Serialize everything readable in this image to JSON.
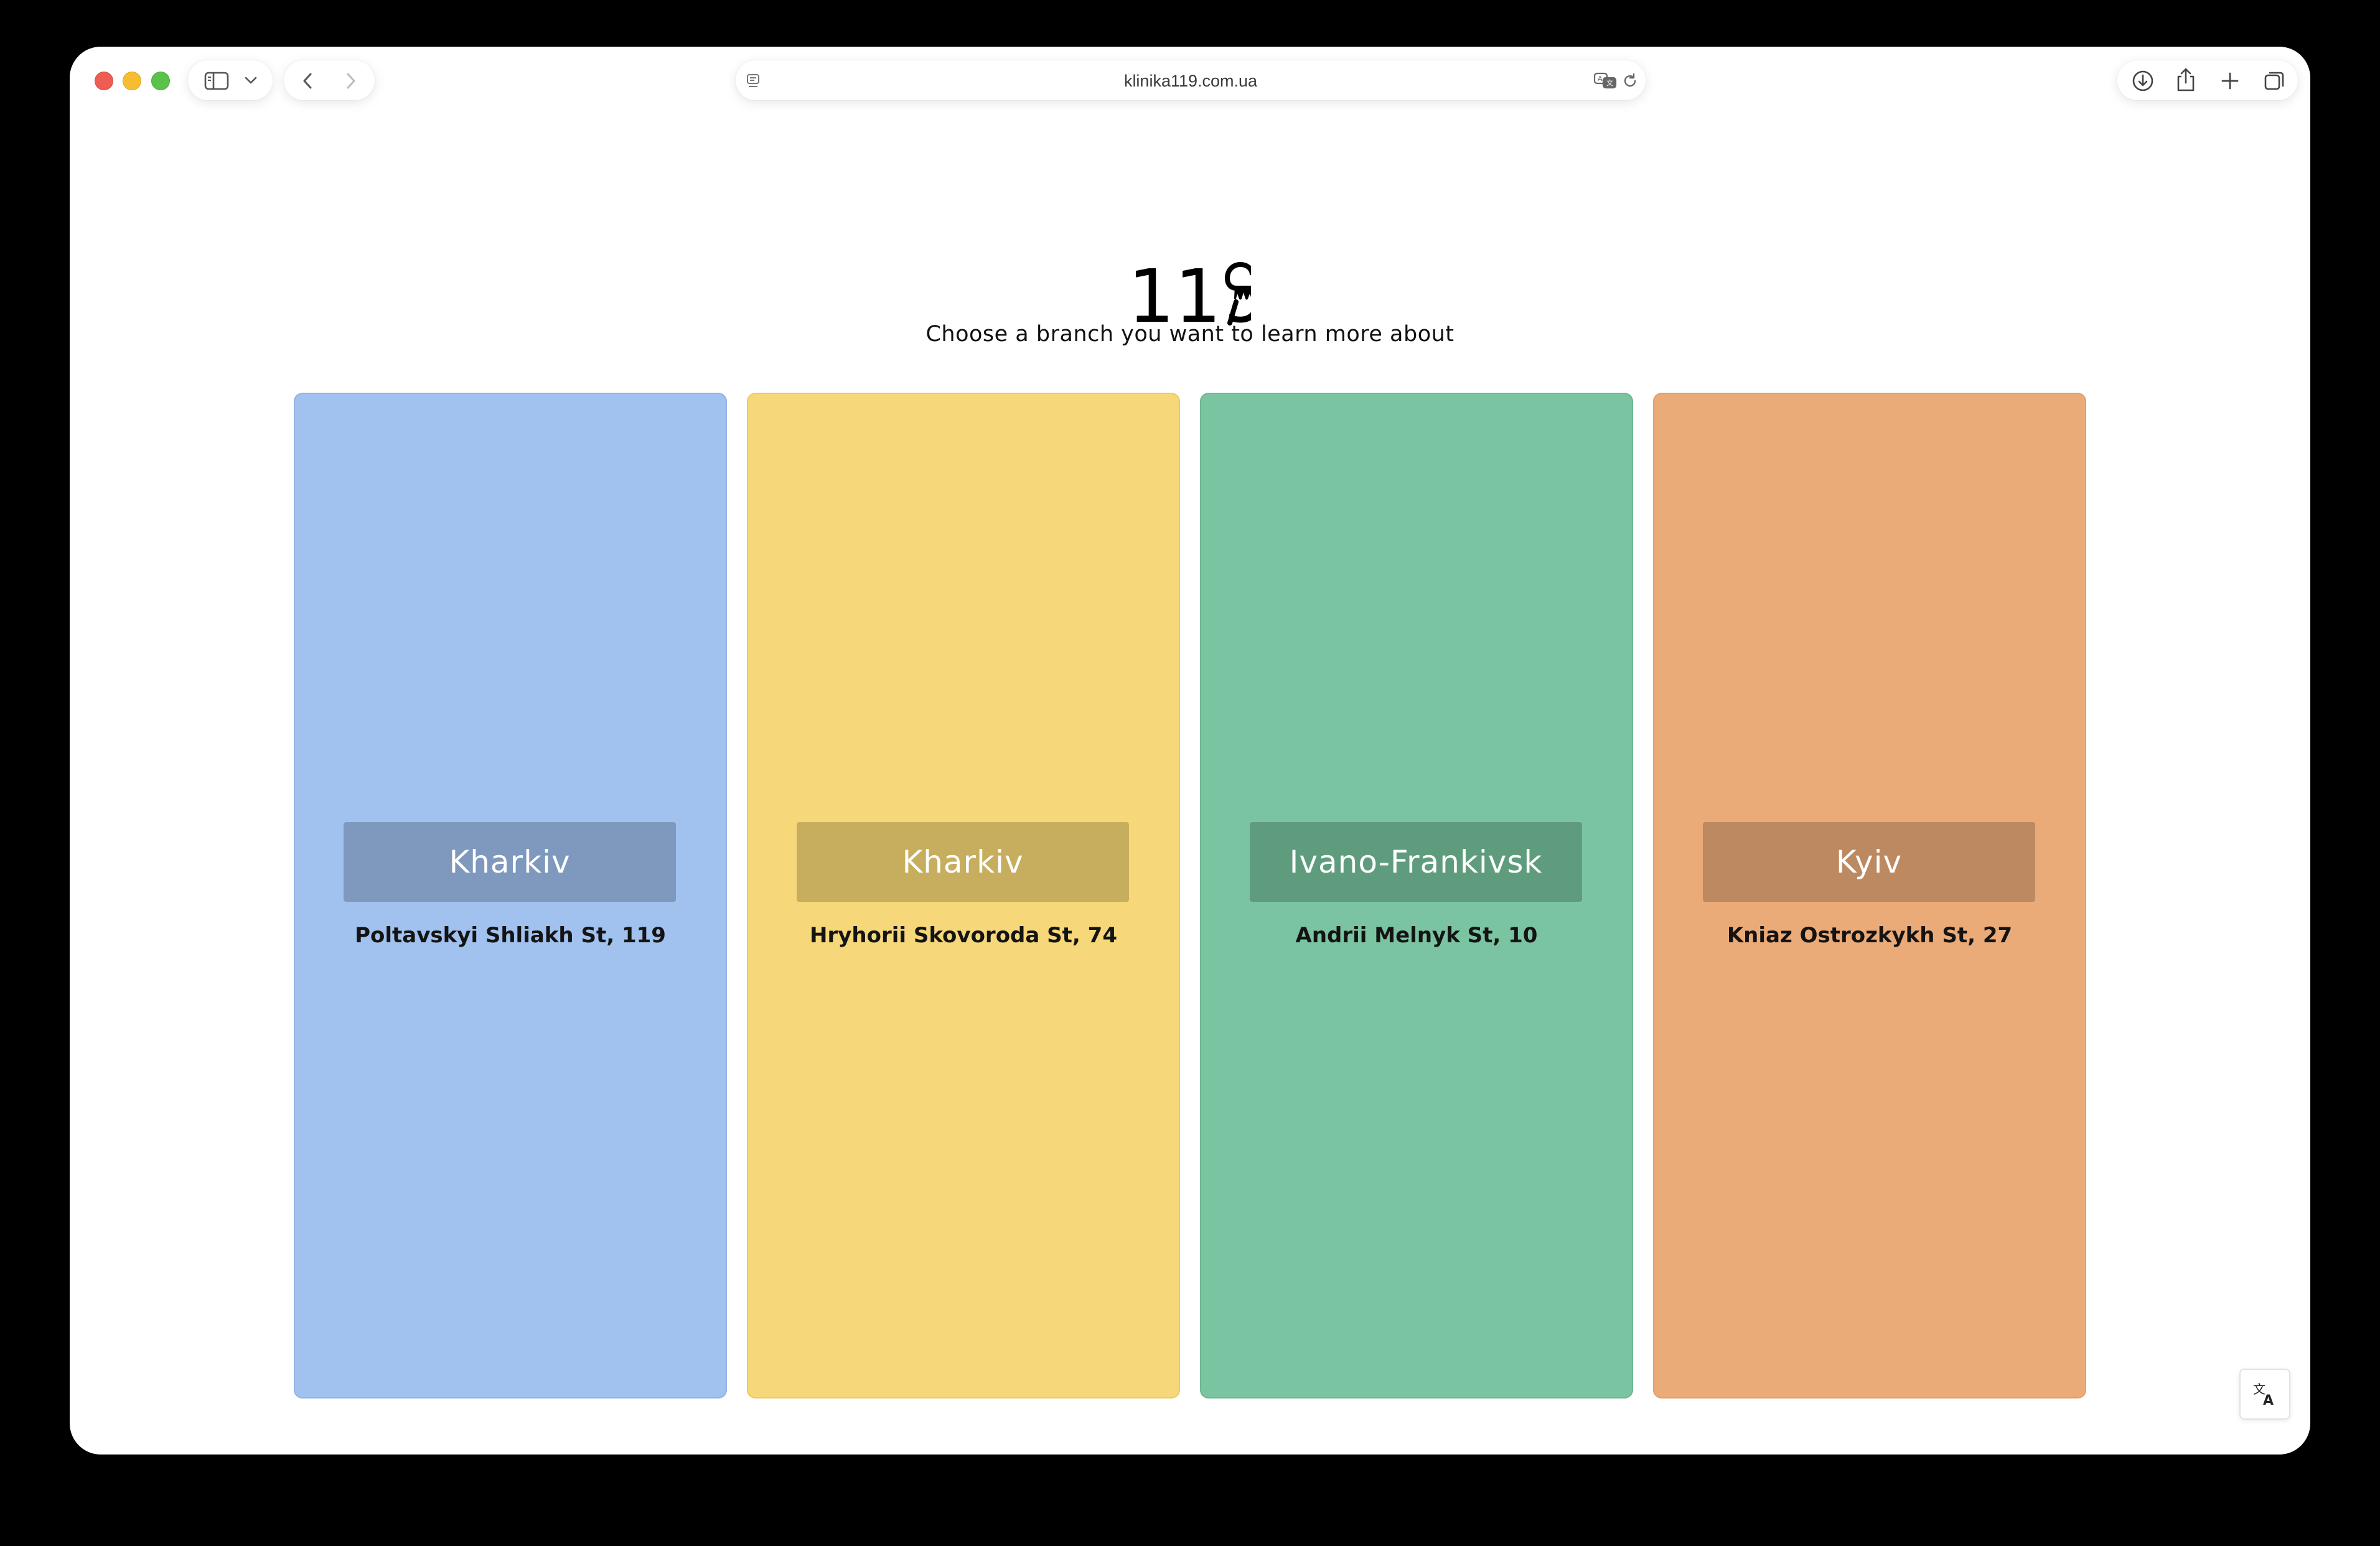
{
  "browser": {
    "url": "klinika119.com.ua"
  },
  "header": {
    "logo_text": "119",
    "subtitle": "Choose a branch you want to learn more about"
  },
  "branches": [
    {
      "city": "Kharkiv",
      "address": "Poltavskyi Shliakh St, 119",
      "color": "#a1c1ee"
    },
    {
      "city": "Kharkiv",
      "address": "Hryhorii Skovoroda St, 74",
      "color": "#f6d87a"
    },
    {
      "city": "Ivano-Frankivsk",
      "address": "Andrii Melnyk St, 10",
      "color": "#7bc4a1"
    },
    {
      "city": "Kyiv",
      "address": "Kniaz Ostrozkykh St, 27",
      "color": "#ebab78"
    }
  ],
  "icons": {
    "sidebar": "sidebar-icon",
    "back": "chevron-left-icon",
    "forward": "chevron-right-icon",
    "reader": "reader-icon",
    "translate_page": "translate-icon",
    "reload": "reload-icon",
    "download": "download-icon",
    "share": "share-icon",
    "new_tab": "plus-icon",
    "tabs": "tabs-overview-icon",
    "translate_widget": "translate-icon"
  }
}
